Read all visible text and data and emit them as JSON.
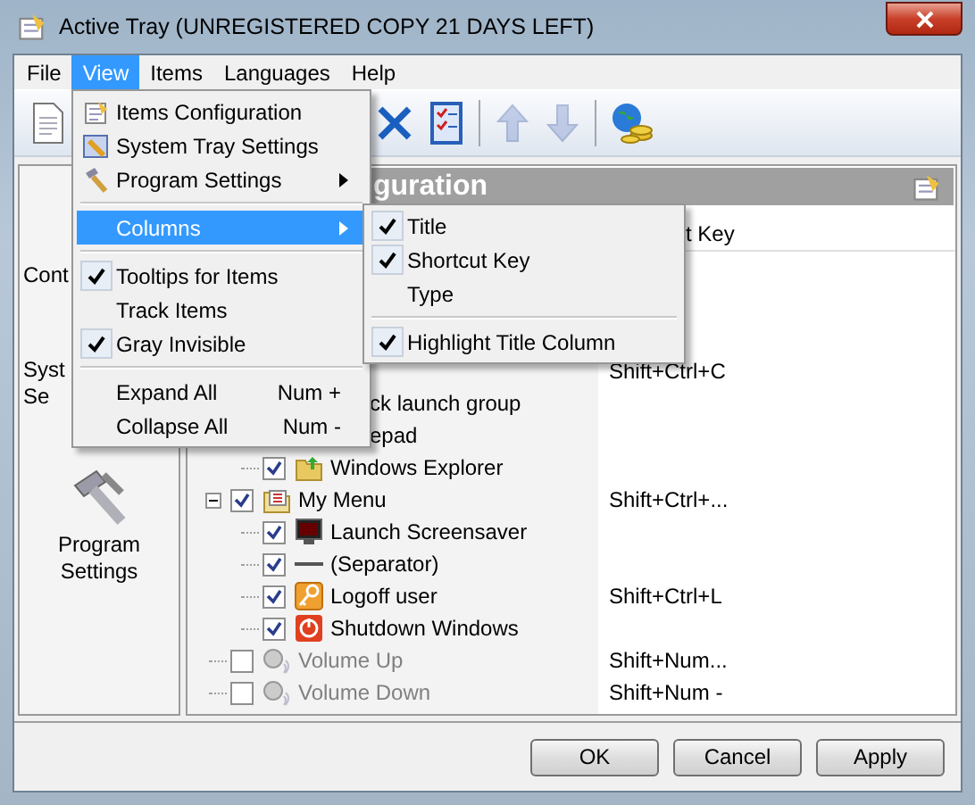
{
  "window": {
    "title": "Active Tray (UNREGISTERED COPY 21 DAYS LEFT)"
  },
  "menu_bar": [
    {
      "label": "File",
      "selected": false
    },
    {
      "label": "View",
      "selected": true
    },
    {
      "label": "Items",
      "selected": false
    },
    {
      "label": "Languages",
      "selected": false
    },
    {
      "label": "Help",
      "selected": false
    }
  ],
  "toolbar": [
    {
      "kind": "document"
    },
    {
      "kind": "delete",
      "disabled": false
    },
    {
      "kind": "checklist",
      "disabled": false
    },
    {
      "kind": "up",
      "disabled": true
    },
    {
      "kind": "down",
      "disabled": true
    },
    {
      "kind": "globe",
      "disabled": false
    }
  ],
  "sidebar": [
    {
      "kind": "cut",
      "lines": [
        "Cont"
      ]
    },
    {
      "kind": "cut",
      "lines": [
        "Syst",
        "Se"
      ]
    },
    {
      "kind": "full",
      "lines": [
        "Program",
        "Settings"
      ]
    }
  ],
  "panel": {
    "title": "guration"
  },
  "columns": [
    {
      "label": "t Key"
    }
  ],
  "tree": [
    {
      "kind": "covered",
      "shortcut": "Shift+Ctrl+C"
    },
    {
      "kind": "covered",
      "title": "ck launch group",
      "children": [
        {
          "kind": "covered",
          "title": "epad"
        },
        {
          "kind": "folder",
          "title": "Windows Explorer",
          "checked": true
        }
      ]
    },
    {
      "kind": "menu",
      "title": "My Menu",
      "checked": true,
      "expanded": true,
      "shortcut": "Shift+Ctrl+...",
      "children": [
        {
          "kind": "monitor",
          "title": "Launch Screensaver",
          "checked": true
        },
        {
          "kind": "separator",
          "title": "(Separator)",
          "checked": true
        },
        {
          "kind": "key",
          "title": "Logoff user",
          "checked": true,
          "shortcut": "Shift+Ctrl+L"
        },
        {
          "kind": "power",
          "title": "Shutdown Windows",
          "checked": true
        }
      ]
    },
    {
      "kind": "speaker",
      "title": "Volume Up",
      "checked": false,
      "shortcut": "Shift+Num..."
    },
    {
      "kind": "speaker",
      "title": "Volume Down",
      "checked": false,
      "shortcut": "Shift+Num -"
    }
  ],
  "view_menu": [
    {
      "kind": "item",
      "label": "Items Configuration",
      "selected": false
    },
    {
      "kind": "item",
      "label": "System Tray Settings",
      "selected": false
    },
    {
      "kind": "submenu",
      "label": "Program Settings",
      "selected": false
    },
    {
      "kind": "separator"
    },
    {
      "kind": "submenu",
      "label": "Columns",
      "selected": true
    },
    {
      "kind": "separator"
    },
    {
      "kind": "check",
      "label": "Tooltips for Items",
      "checked": true,
      "selected": false
    },
    {
      "kind": "check",
      "label": "Track Items",
      "checked": false,
      "selected": false
    },
    {
      "kind": "check",
      "label": "Gray Invisible",
      "checked": true,
      "selected": false
    },
    {
      "kind": "separator"
    },
    {
      "kind": "item",
      "label": "Expand All",
      "shortcut": "Num +",
      "selected": false
    },
    {
      "kind": "item",
      "label": "Collapse All",
      "shortcut": "Num -",
      "selected": false
    }
  ],
  "columns_menu": [
    {
      "kind": "check",
      "label": "Title",
      "checked": true
    },
    {
      "kind": "check",
      "label": "Shortcut Key",
      "checked": true
    },
    {
      "kind": "check",
      "label": "Type",
      "checked": false
    },
    {
      "kind": "separator"
    },
    {
      "kind": "check",
      "label": "Highlight Title Column",
      "checked": true
    }
  ],
  "buttons": [
    {
      "label": "OK"
    },
    {
      "label": "Cancel"
    },
    {
      "label": "Apply"
    }
  ]
}
